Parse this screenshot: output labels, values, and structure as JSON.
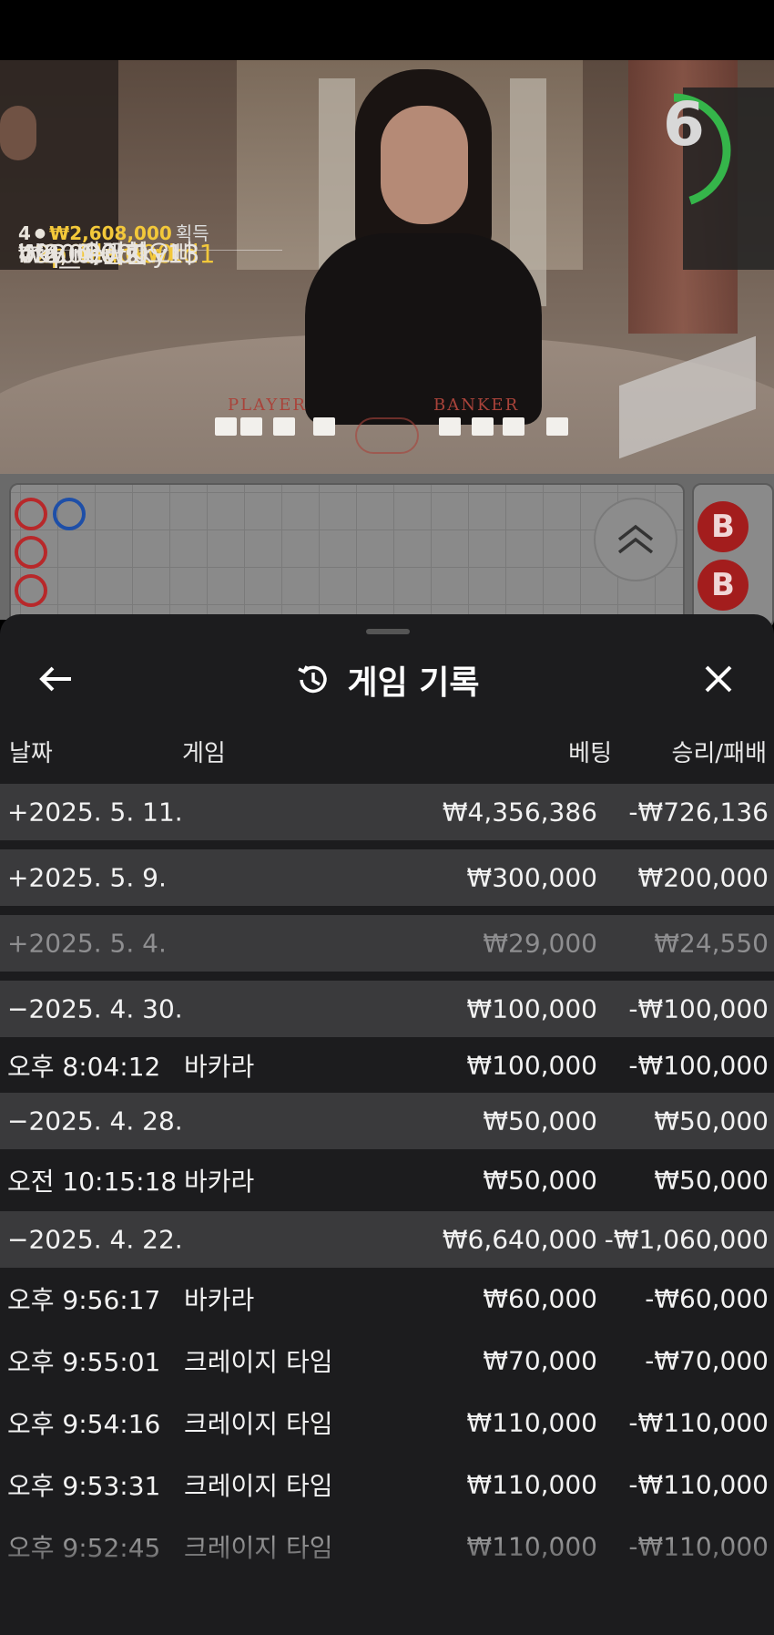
{
  "winners": {
    "count": "4",
    "total": "₩2,608,000",
    "total_label": "획득",
    "list": [
      {
        "amount": "₩2,000,000",
        "name": "b2p_blackwkd1"
      },
      {
        "amount": "₩400,000",
        "name": "bkv_매끈한오빠"
      },
      {
        "amount": "₩200,000",
        "name": "bfq_newsky13"
      },
      {
        "amount": "₩8,000",
        "name": "493_으라차"
      }
    ]
  },
  "table_labels": {
    "player": "PLAYER",
    "banker": "BANKER"
  },
  "timer": {
    "seconds": "6",
    "progress": 0.45
  },
  "roadmap": {
    "side_badge": "B"
  },
  "history": {
    "title": "게임 기록",
    "icons": {
      "back": "arrow-left-icon",
      "title": "history-icon",
      "close": "close-icon"
    },
    "columns": {
      "date": "날짜",
      "game": "게임",
      "bet": "베팅",
      "result": "승리/패배"
    },
    "rows": [
      {
        "type": "date",
        "date": "+2025. 5. 11.",
        "game": "",
        "bet": "₩4,356,386",
        "result": "-₩726,136"
      },
      {
        "type": "date",
        "date": "+2025. 5. 9.",
        "game": "",
        "bet": "₩300,000",
        "result": "₩200,000"
      },
      {
        "type": "date",
        "date": "+2025. 5. 4.",
        "game": "",
        "bet": "₩29,000",
        "result": "₩24,550"
      },
      {
        "type": "date",
        "date": "−2025. 4. 30.",
        "game": "",
        "bet": "₩100,000",
        "result": "-₩100,000"
      },
      {
        "type": "game",
        "date": "오후 8:04:12",
        "game": "바카라",
        "bet": "₩100,000",
        "result": "-₩100,000"
      },
      {
        "type": "date",
        "date": "−2025. 4. 28.",
        "game": "",
        "bet": "₩50,000",
        "result": "₩50,000"
      },
      {
        "type": "game",
        "date": "오전 10:15:18",
        "game": "바카라",
        "bet": "₩50,000",
        "result": "₩50,000"
      },
      {
        "type": "date",
        "date": "−2025. 4. 22.",
        "game": "",
        "bet": "₩6,640,000",
        "result": "-₩1,060,000"
      },
      {
        "type": "game",
        "date": "오후 9:56:17",
        "game": "바카라",
        "bet": "₩60,000",
        "result": "-₩60,000"
      },
      {
        "type": "game",
        "date": "오후 9:55:01",
        "game": "크레이지 타임",
        "bet": "₩70,000",
        "result": "-₩70,000"
      },
      {
        "type": "game",
        "date": "오후 9:54:16",
        "game": "크레이지 타임",
        "bet": "₩110,000",
        "result": "-₩110,000"
      },
      {
        "type": "game",
        "date": "오후 9:53:31",
        "game": "크레이지 타임",
        "bet": "₩110,000",
        "result": "-₩110,000"
      },
      {
        "type": "game",
        "date": "오후 9:52:45",
        "game": "크레이지 타임",
        "bet": "₩110,000",
        "result": "-₩110,000"
      }
    ]
  }
}
